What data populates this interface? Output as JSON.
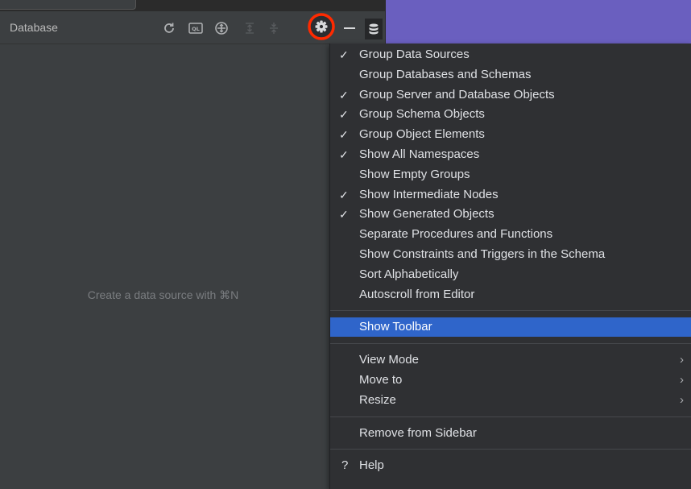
{
  "panel": {
    "title": "Database",
    "empty_text": "Create a data source with ⌘N",
    "toolbar_icons": [
      "refresh-icon",
      "query-console-icon",
      "jump-to-source-icon",
      "expand-all-icon",
      "collapse-all-icon",
      "gear-icon",
      "minimize-icon",
      "database-icon"
    ],
    "highlight_color": "#ff2a00"
  },
  "menu": {
    "groups": [
      [
        {
          "label": "Group Data Sources",
          "checked": true
        },
        {
          "label": "Group Databases and Schemas",
          "checked": false
        },
        {
          "label": "Group Server and Database Objects",
          "checked": true
        },
        {
          "label": "Group Schema Objects",
          "checked": true
        },
        {
          "label": "Group Object Elements",
          "checked": true
        },
        {
          "label": "Show All Namespaces",
          "checked": true
        },
        {
          "label": "Show Empty Groups",
          "checked": false
        },
        {
          "label": "Show Intermediate Nodes",
          "checked": true
        },
        {
          "label": "Show Generated Objects",
          "checked": true
        },
        {
          "label": "Separate Procedures and Functions",
          "checked": false
        },
        {
          "label": "Show Constraints and Triggers in the Schema",
          "checked": false
        },
        {
          "label": "Sort Alphabetically",
          "checked": false
        },
        {
          "label": "Autoscroll from Editor",
          "checked": false
        }
      ],
      [
        {
          "label": "Show Toolbar",
          "checked": false,
          "selected": true
        }
      ],
      [
        {
          "label": "View Mode",
          "submenu": true
        },
        {
          "label": "Move to",
          "submenu": true
        },
        {
          "label": "Resize",
          "submenu": true
        }
      ],
      [
        {
          "label": "Remove from Sidebar"
        }
      ]
    ],
    "help": {
      "mark": "?",
      "label": "Help"
    },
    "check_glyph": "✓",
    "submenu_glyph": "›"
  },
  "colors": {
    "panel_bg": "#3c3f41",
    "menu_bg": "#2f3033",
    "selected_bg": "#2f65ca",
    "purple_bg": "#6a5fbf"
  }
}
